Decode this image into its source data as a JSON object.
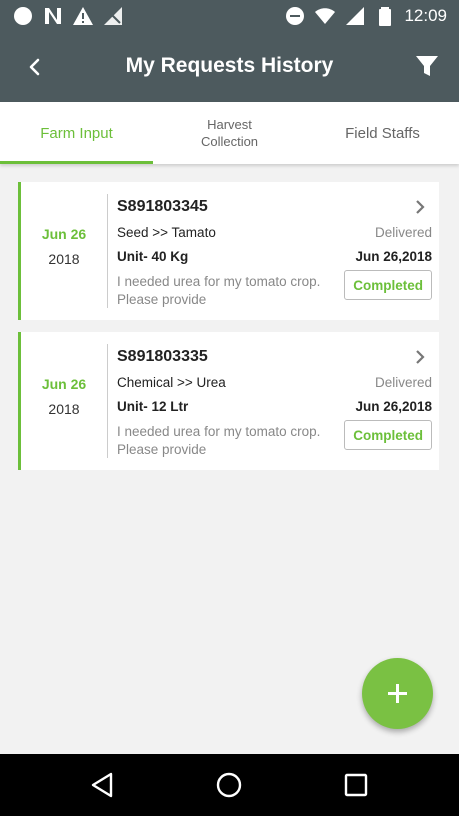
{
  "status_bar": {
    "time": "12:09",
    "icons_left": [
      "circle-icon",
      "nfc-icon",
      "warning-icon",
      "no-signal-icon"
    ],
    "icons_right": [
      "dnd-icon",
      "wifi-icon",
      "signal-icon",
      "battery-icon"
    ]
  },
  "header": {
    "title": "My Requests History",
    "back_icon": "back-arrow-icon",
    "filter_icon": "filter-icon"
  },
  "tabs": [
    {
      "label": "Farm Input",
      "active": true
    },
    {
      "label": "Harvest\nCollection",
      "active": false
    },
    {
      "label": "Field Staffs",
      "active": false
    }
  ],
  "requests": [
    {
      "date_md": "Jun 26",
      "date_year": "2018",
      "id": "S891803345",
      "item": "Seed >> Tamato",
      "delivery_status": "Delivered",
      "unit": "Unit- 40 Kg",
      "delivery_date": "Jun 26,2018",
      "description": "I needed urea for my tomato crop. Please provide",
      "status": "Completed"
    },
    {
      "date_md": "Jun 26",
      "date_year": "2018",
      "id": "S891803335",
      "item": "Chemical >> Urea",
      "delivery_status": "Delivered",
      "unit": "Unit- 12 Ltr",
      "delivery_date": "Jun 26,2018",
      "description": "I needed urea for my tomato crop. Please provide",
      "status": "Completed"
    }
  ],
  "colors": {
    "accent": "#6cbf3a",
    "toolbar": "#4d5a5e",
    "fab": "#7ac143"
  }
}
